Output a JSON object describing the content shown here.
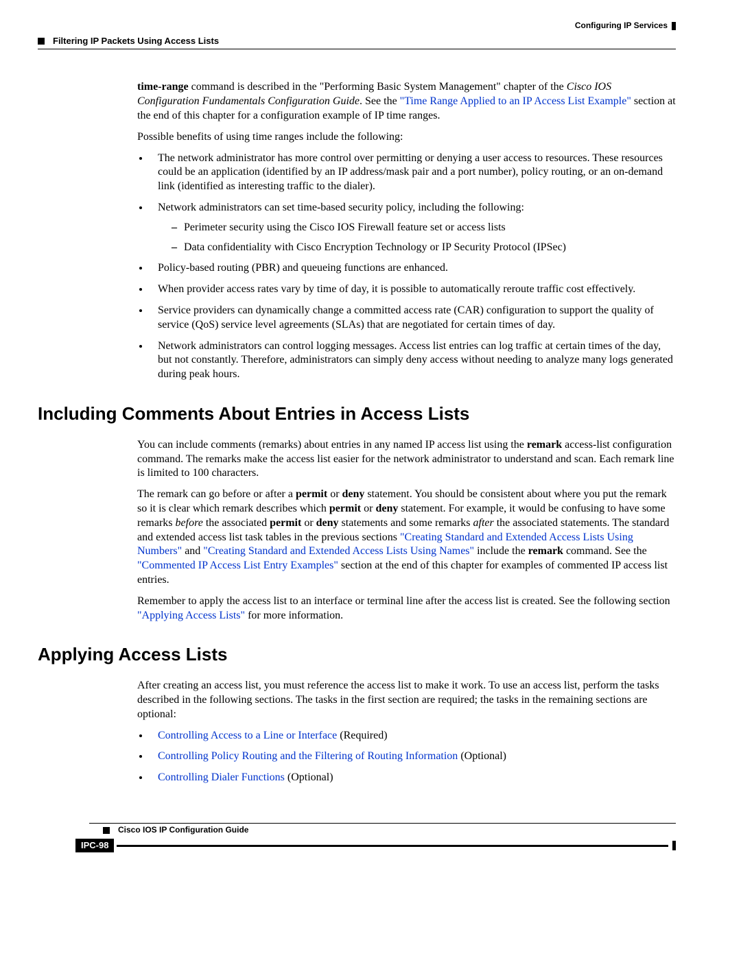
{
  "header": {
    "chapter": "Configuring IP Services",
    "section": "Filtering IP Packets Using Access Lists"
  },
  "intro": {
    "p1a": "time-range",
    "p1b": " command is described in the \"Performing Basic System Management\" chapter of the ",
    "p1c": "Cisco IOS Configuration Fundamentals Configuration Guide",
    "p1d": ". See the ",
    "p1link": "\"Time Range Applied to an IP Access List Example\"",
    "p1e": " section at the end of this chapter for a configuration example of IP time ranges.",
    "p2": "Possible benefits of using time ranges include the following:",
    "b1": "The network administrator has more control over permitting or denying a user access to resources. These resources could be an application (identified by an IP address/mask pair and a port number), policy routing, or an on-demand link (identified as interesting traffic to the dialer).",
    "b2": "Network administrators can set time-based security policy, including the following:",
    "b2a": "Perimeter security using the Cisco IOS Firewall feature set or access lists",
    "b2b": "Data confidentiality with Cisco Encryption Technology or IP Security Protocol (IPSec)",
    "b3": "Policy-based routing (PBR) and queueing functions are enhanced.",
    "b4": "When provider access rates vary by time of day, it is possible to automatically reroute traffic cost effectively.",
    "b5": "Service providers can dynamically change a committed access rate (CAR) configuration to support the quality of service (QoS) service level agreements (SLAs) that are negotiated for certain times of day.",
    "b6": "Network administrators can control logging messages. Access list entries can log traffic at certain times of the day, but not constantly. Therefore, administrators can simply deny access without needing to analyze many logs generated during peak hours."
  },
  "sec1": {
    "title": "Including Comments About Entries in Access Lists",
    "p1a": "You can include comments (remarks) about entries in any named IP access list using the ",
    "p1b": "remark",
    "p1c": " access-list configuration command. The remarks make the access list easier for the network administrator to understand and scan. Each remark line is limited to 100 characters.",
    "p2a": "The remark can go before or after a ",
    "p2b": "permit",
    "p2c": " or ",
    "p2d": "deny",
    "p2e": " statement. You should be consistent about where you put the remark so it is clear which remark describes which ",
    "p2f": "permit",
    "p2g": " or ",
    "p2h": "deny",
    "p2i": " statement. For example, it would be confusing to have some remarks ",
    "p2j": "before",
    "p2k": " the associated ",
    "p2l": "permit",
    "p2m": " or ",
    "p2n": "deny",
    "p2o": " statements and some remarks ",
    "p2p": "after",
    "p2q": " the associated statements. The standard and extended access list task tables in the previous sections ",
    "p2link1": "\"Creating Standard and Extended Access Lists Using Numbers\"",
    "p2r": " and ",
    "p2link2": "\"Creating Standard and Extended Access Lists Using Names\"",
    "p2s": " include the ",
    "p2t": "remark",
    "p2u": " command. See the ",
    "p2link3": "\"Commented IP Access List Entry Examples\"",
    "p2v": " section at the end of this chapter for examples of commented IP access list entries.",
    "p3a": "Remember to apply the access list to an interface or terminal line after the access list is created. See the following section ",
    "p3link": "\"Applying Access Lists\"",
    "p3b": " for more information."
  },
  "sec2": {
    "title": "Applying Access Lists",
    "p1": "After creating an access list, you must reference the access list to make it work. To use an access list, perform the tasks described in the following sections. The tasks in the first section are required; the tasks in the remaining sections are optional:",
    "b1": "Controlling Access to a Line or Interface",
    "b1s": " (Required)",
    "b2": "Controlling Policy Routing and the Filtering of Routing Information",
    "b2s": " (Optional)",
    "b3": "Controlling Dialer Functions",
    "b3s": " (Optional)"
  },
  "footer": {
    "guide": "Cisco IOS IP Configuration Guide",
    "page": "IPC-98"
  }
}
